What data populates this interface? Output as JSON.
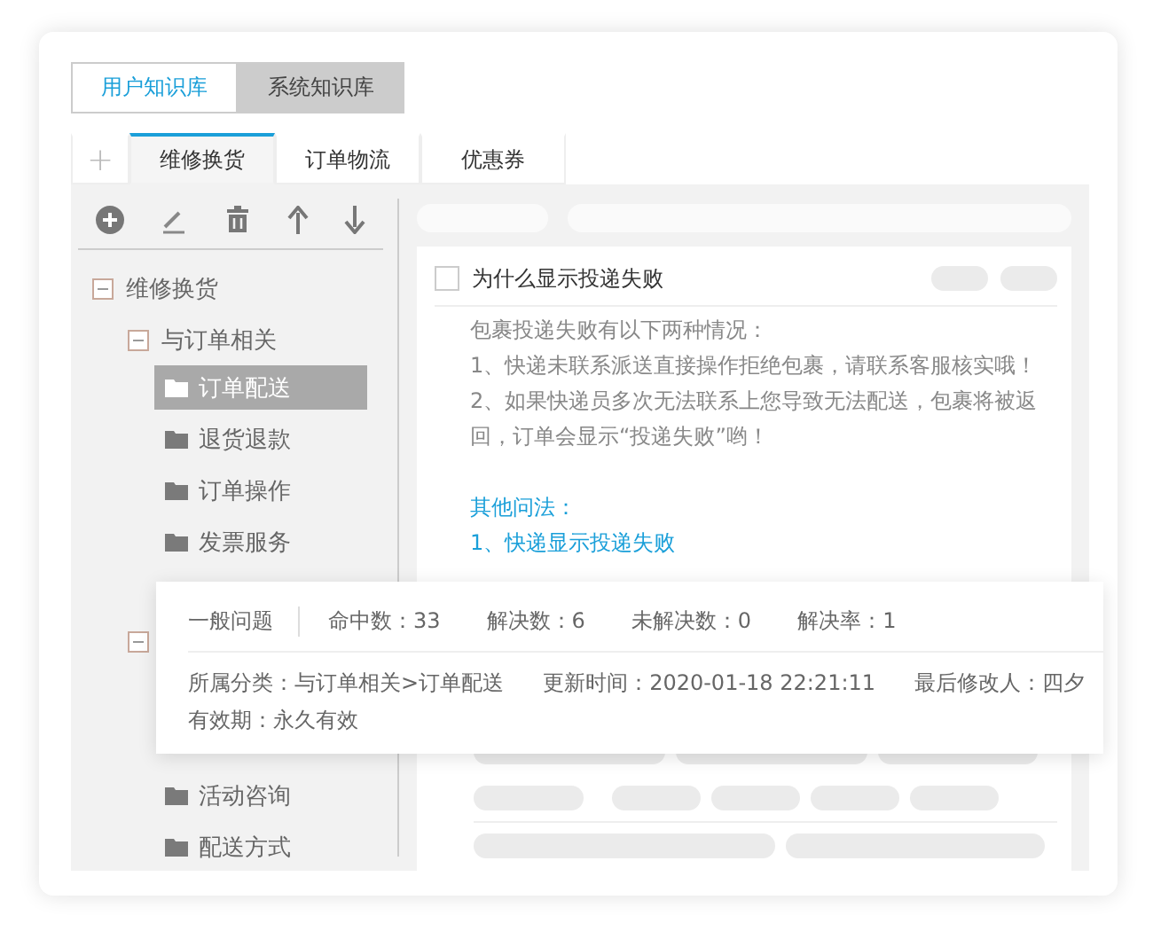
{
  "library_switch": [
    {
      "label": "用户知识库",
      "selected": true
    },
    {
      "label": "系统知识库",
      "selected": false
    }
  ],
  "tab_add": "+",
  "tabs": [
    {
      "label": "维修换货",
      "selected": true
    },
    {
      "label": "订单物流",
      "selected": false
    },
    {
      "label": "优惠券",
      "selected": false
    }
  ],
  "tree": [
    {
      "label": "维修换货",
      "expanded": true,
      "children": [
        {
          "label": "与订单相关",
          "expanded": true,
          "children": [
            {
              "label": "订单配送",
              "selected": true
            },
            {
              "label": "退货退款",
              "selected": false
            },
            {
              "label": "订单操作",
              "selected": false
            },
            {
              "label": "发票服务",
              "selected": false
            }
          ]
        },
        {
          "expanded": true,
          "children": [
            {
              "label": "活动咨询",
              "selected": false
            },
            {
              "label": "配送方式",
              "selected": false
            }
          ]
        }
      ]
    }
  ],
  "question": {
    "checked": false,
    "title": "为什么显示投递失败",
    "answer": [
      "包裹投递失败有以下两种情况：",
      "1、快递未联系派送直接操作拒绝包裹，请联系客服核实哦！",
      "2、如果快递员多次无法联系上您导致无法配送，包裹将被返回，订单会显示“投递失败”哟！"
    ],
    "other_heading": "其他问法：",
    "other_questions": [
      "1、快递显示投递失败"
    ]
  },
  "popup": {
    "type": "一般问题",
    "stats": [
      "命中数：33",
      "解决数：6",
      "未解决数：0",
      "解决率：1"
    ],
    "details": [
      "所属分类：与订单相关>订单配送",
      "更新时间：2020-01-18 22:21:11",
      "最后修改人：四夕",
      "有效期：永久有效"
    ]
  }
}
